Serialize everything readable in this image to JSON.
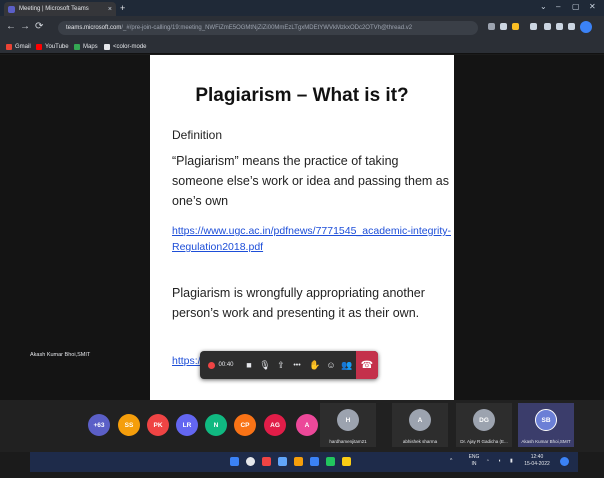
{
  "browser": {
    "tab_title": "Meeting | Microsoft Teams",
    "tab_close": "×",
    "new_tab": "+",
    "url_host": "teams.microsoft.com",
    "url_path": "/_#/pre-join-calling/19:meeting_NWFiZmE5OGMtNjZiZi00MmEzLTgxMDEtYWVkMzkxODc2OTVh@thread.v2",
    "bookmarks": [
      "Gmail",
      "YouTube",
      "Maps",
      "<color-mode"
    ]
  },
  "slide": {
    "title": "Plagiarism – What is it?",
    "definition_heading": "Definition",
    "definition_text": "“Plagiarism” means the practice of taking someone else’s work or idea and passing them as one’s own",
    "link_url": "https://www.ugc.ac.in/pdfnews/7771545_academic-integrity-Regulation2018.pdf",
    "statement": "Plagiarism is wrongfully appropriating another person’s work and presenting it as their own.",
    "link_partial": "https://"
  },
  "presenter_label": "Akash Kumar Bhoi,SMIT",
  "toolbar": {
    "timer": "00:40",
    "more": "•••"
  },
  "participants": {
    "overflow": "+63",
    "avatars": [
      {
        "initials": "SS",
        "color": "#f59e0b"
      },
      {
        "initials": "PK",
        "color": "#ef4444"
      },
      {
        "initials": "LR",
        "color": "#6366f1"
      },
      {
        "initials": "N",
        "color": "#10b981"
      },
      {
        "initials": "CP",
        "color": "#f97316"
      },
      {
        "initials": "AG",
        "color": "#e11d48"
      },
      {
        "initials": "A",
        "color": "#ec4899"
      }
    ],
    "tiles": [
      {
        "initials": "H",
        "name": "hardhamenjitam21",
        "color": "#9ca3af"
      },
      {
        "initials": "A",
        "name": "abhishek sharma",
        "color": "#9ca3af"
      },
      {
        "initials": "DG",
        "name": "Dr. Ajay R Gadicha (E...",
        "color": "#9ca3af"
      },
      {
        "initials": "SB",
        "name": "Akash Kumar Bhoi,SMIT",
        "color": "#6b7fd6"
      }
    ]
  },
  "taskbar": {
    "lang": "ENG IN",
    "time": "12:40",
    "date": "15-04-2022"
  },
  "colors": {
    "teams_purple": "#5b5fc7",
    "hangup_red": "#c4314b",
    "record_red": "#ef4444"
  }
}
